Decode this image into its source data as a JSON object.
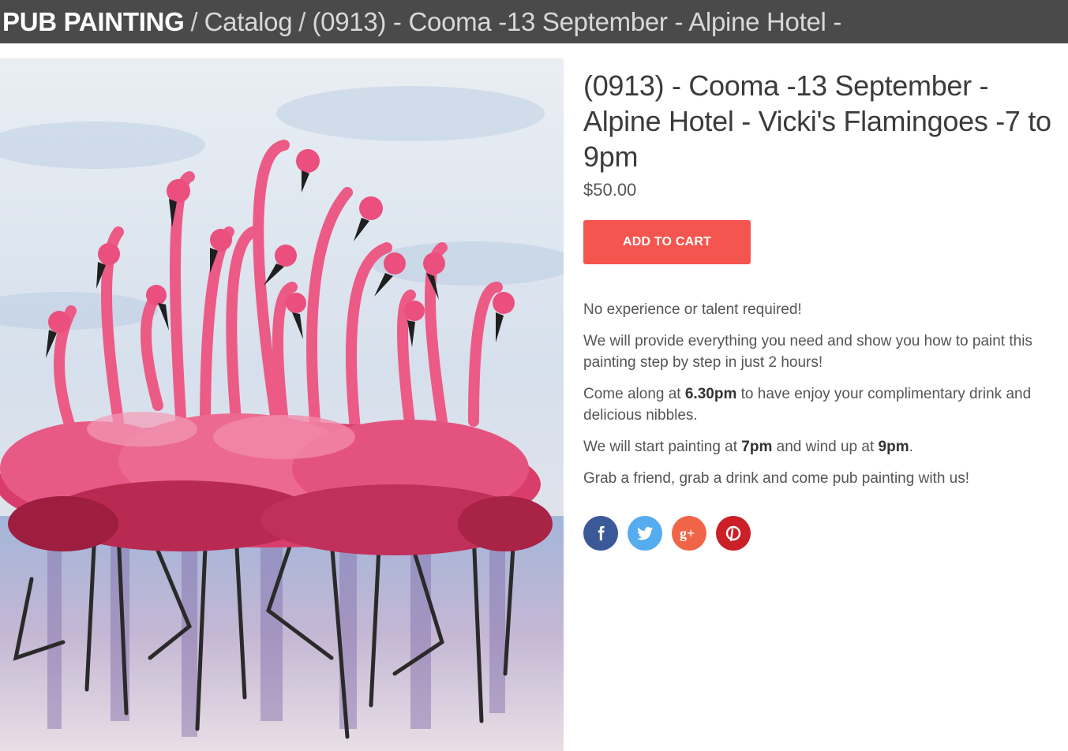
{
  "breadcrumb": {
    "brand": "PUB PAINTING",
    "separator": "/",
    "catalog": "Catalog",
    "current": "(0913) - Cooma -13 September - Alpine Hotel -"
  },
  "product": {
    "title": "(0913) - Cooma -13 September - Alpine Hotel - Vicki's Flamingoes -7 to 9pm",
    "price": "$50.00",
    "add_to_cart_label": "ADD TO CART",
    "image_description": "Acrylic painting of a flock of pink flamingos"
  },
  "description": {
    "p1": "No experience or talent required!",
    "p2": "We will provide everything you need and show you how to paint this painting step by step in just 2 hours!",
    "p3_before": "Come along at ",
    "p3_bold": "6.30pm",
    "p3_after": " to have enjoy your complimentary drink and delicious nibbles.",
    "p4_before": "We will start painting at ",
    "p4_bold1": "7pm",
    "p4_mid": " and wind up at ",
    "p4_bold2": "9pm",
    "p4_after": ".",
    "p5": "Grab a friend, grab a drink and come pub painting with us!"
  },
  "social": [
    {
      "name": "facebook-icon",
      "color": "#3b5998"
    },
    {
      "name": "twitter-icon",
      "color": "#55acee"
    },
    {
      "name": "google-plus-icon",
      "color": "#f06548"
    },
    {
      "name": "pinterest-icon",
      "color": "#cb2027"
    }
  ]
}
